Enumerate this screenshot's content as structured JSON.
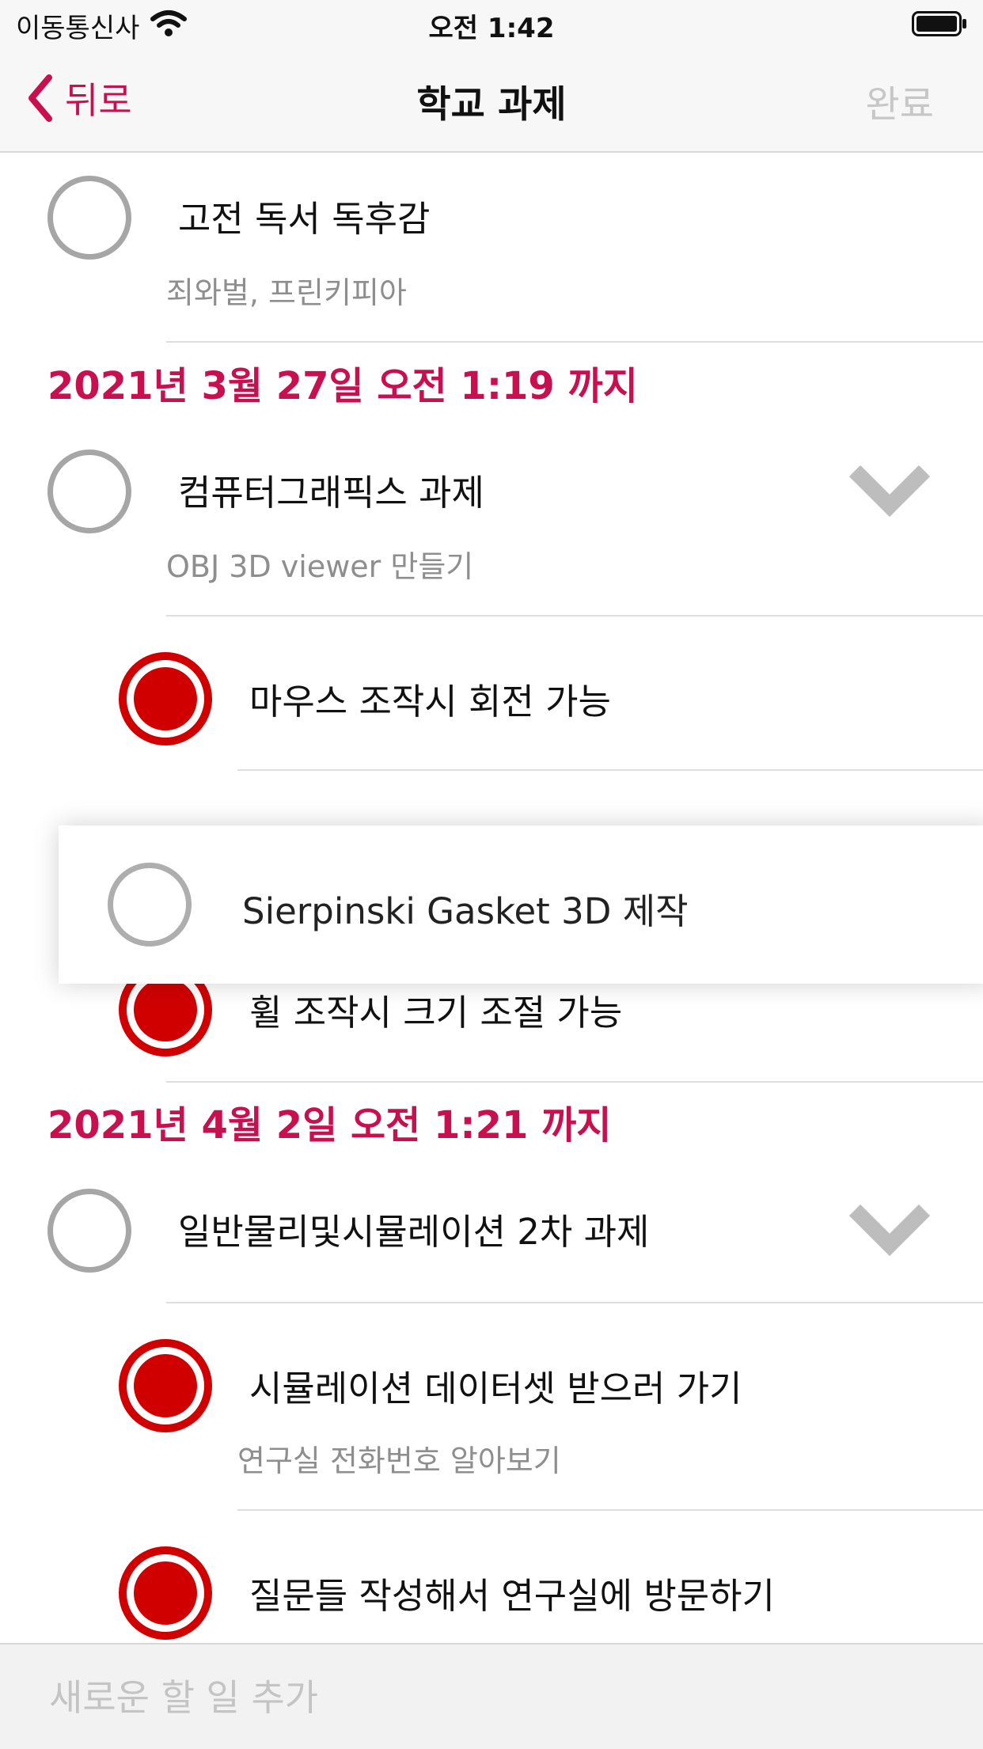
{
  "status": {
    "carrier": "이동통신사",
    "time": "오전 1:42"
  },
  "nav": {
    "back_label": "뒤로",
    "title": "학교 과제",
    "done_label": "완료"
  },
  "items": [
    {
      "title": "고전 독서 독후감",
      "note": "죄와벌, 프린키피아"
    }
  ],
  "sections": [
    {
      "header": "2021년 3월 27일 오전 1:19 까지",
      "task": {
        "title": "컴퓨터그래픽스 과제",
        "note": "OBJ 3D viewer 만들기"
      },
      "subtasks": [
        {
          "title": "마우스 조작시 회전 가능"
        },
        {
          "title": "휠 조작시 크기 조절 가능"
        }
      ]
    },
    {
      "header": "2021년 4월 2일 오전 1:21 까지",
      "task": {
        "title": "일반물리및시뮬레이션 2차 과제",
        "note": ""
      },
      "subtasks": [
        {
          "title": "시뮬레이션 데이터셋 받으러 가기",
          "note": "연구실 전화번호 알아보기"
        },
        {
          "title": "질문들 작성해서 연구실에 방문하기"
        }
      ]
    }
  ],
  "dragging_item": {
    "title": "Sierpinski Gasket 3D 제작"
  },
  "new_task": {
    "placeholder": "새로운 할 일 추가"
  },
  "colors": {
    "accent": "#c8104f",
    "radio_red": "#d10000",
    "ring_gray": "#a6a6a6"
  }
}
